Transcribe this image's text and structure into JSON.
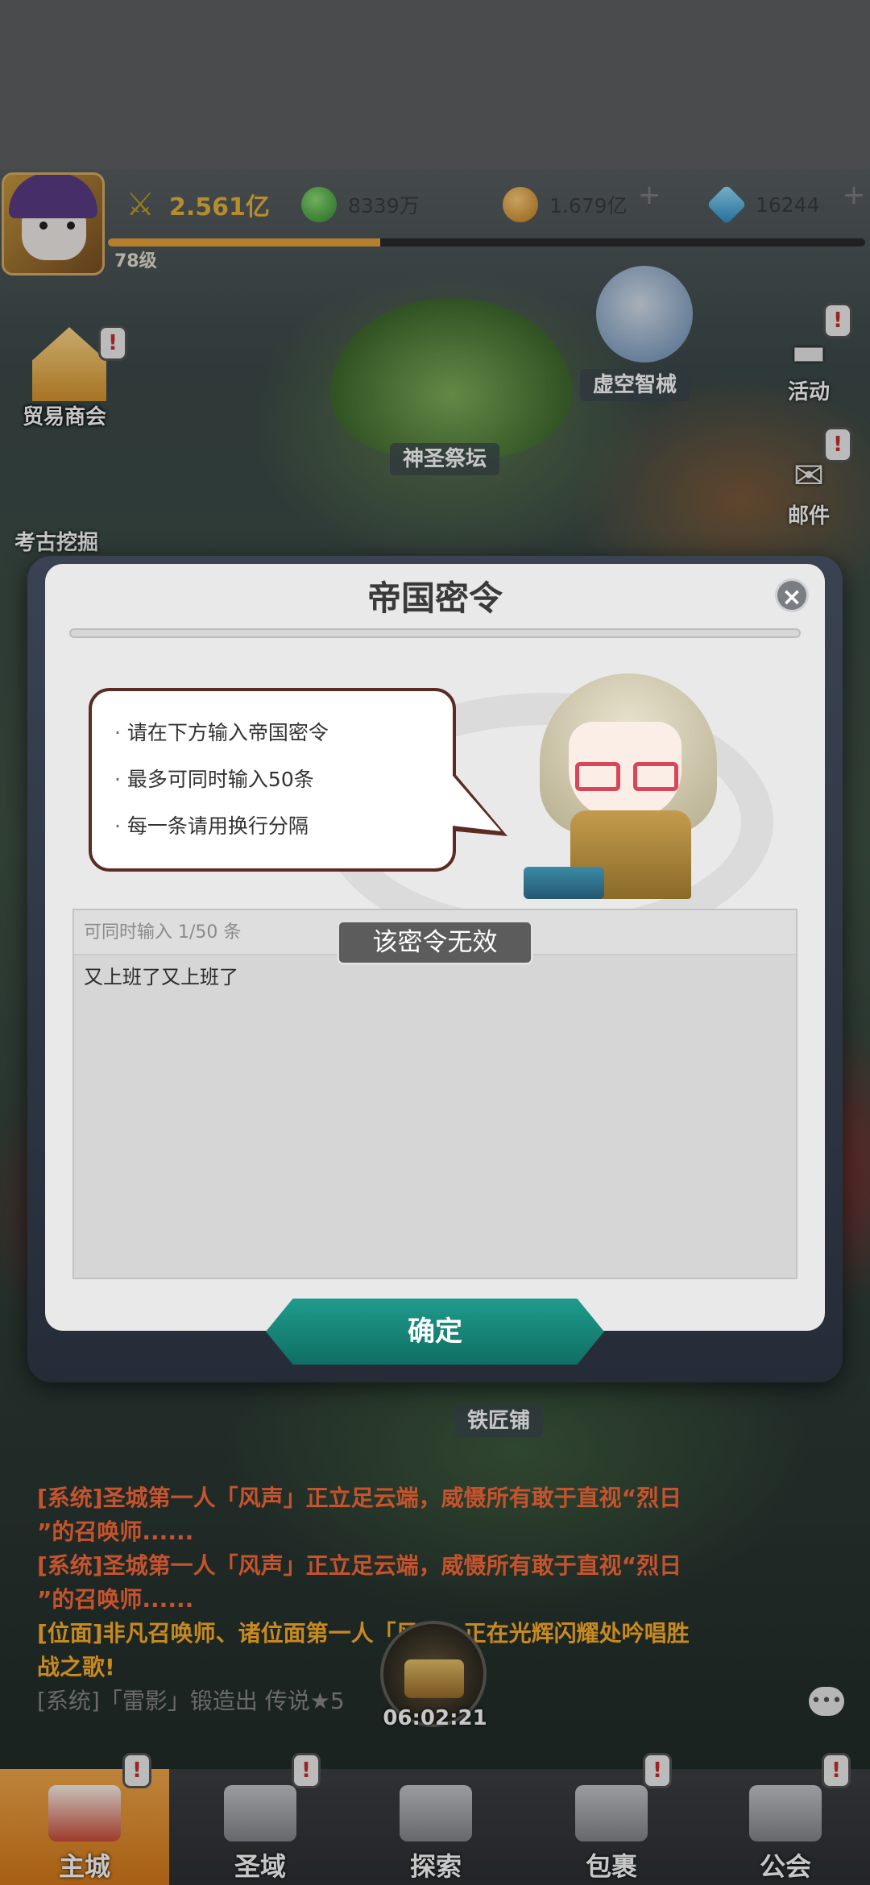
{
  "topbar": {
    "power": "2.561亿",
    "green_currency": "8339万",
    "gold_currency": "1.679亿",
    "gems": "16244",
    "level": "78级",
    "xp_fraction": 0.36
  },
  "map": {
    "trade": "贸易商会",
    "altar": "神圣祭坛",
    "mech": "虚空智械",
    "arch": "考古挖掘",
    "smith": "铁匠铺",
    "activity": "活动",
    "mail": "邮件",
    "badge": "!"
  },
  "modal": {
    "title": "帝国密令",
    "close": "×",
    "tips": [
      "请在下方输入帝国密令",
      "最多可同时输入50条",
      "每一条请用换行分隔"
    ],
    "counter": "可同时输入 1/50 条",
    "input_value": "又上班了又上班了",
    "toast": "该密令无效",
    "confirm": "确定"
  },
  "chat": {
    "line1a": "[系统]圣城第一人「风声」正立足云端，威慑所有敢于直视“烈日",
    "line1b": "”的召唤师......",
    "line2a": "[系统]圣城第一人「风声」正立足云端，威慑所有敢于直视“烈日",
    "line2b": "”的召唤师......",
    "line3a": "[位面]非凡召唤师、诸位面第一人「风声」正在光辉闪耀处吟唱胜",
    "line3b": "战之歌!",
    "line4": "[系统]「雷影」锻造出 传说★5"
  },
  "chest_timer": "06:02:21",
  "nav": {
    "city": "主城",
    "holy": "圣域",
    "explore": "探索",
    "bag": "包裹",
    "guild": "公会"
  },
  "colors": {
    "accent": "#0f6e63",
    "toast": "#5c5c5c",
    "power": "#e8b53a"
  }
}
